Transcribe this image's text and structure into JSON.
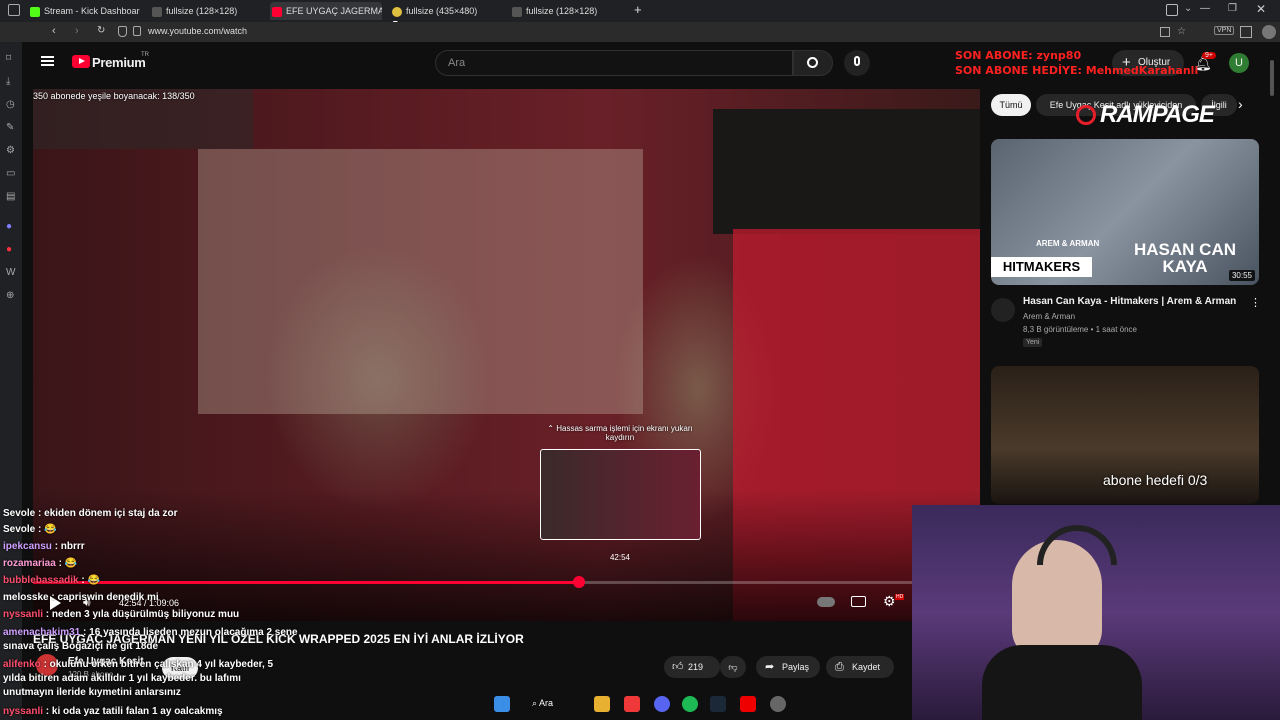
{
  "browser": {
    "tabs": [
      {
        "label": "Stream - Kick Dashboard",
        "color": "#53fc18"
      },
      {
        "label": "fullsize (128×128)",
        "color": "#888888"
      },
      {
        "label": "EFE UYGAÇ JAGERMAN YENİ",
        "color": "#ff0033"
      },
      {
        "label": "fullsize (435×480)",
        "color": "#888888"
      },
      {
        "label": "fullsize (128×128)",
        "color": "#888888"
      }
    ],
    "new_tab": "+",
    "badge_x5": "x5",
    "url": "www.youtube.com/watch",
    "vpn": "VPN"
  },
  "youtube": {
    "logo": "Premium",
    "logo_sup": "TR",
    "search_placeholder": "Ara",
    "create_label": "Oluştur",
    "notif_count": "9+",
    "avatar_letter": "U"
  },
  "overlay": {
    "last_sub": "SON ABONE: zynp80",
    "last_sub_gift": "SON ABONE HEDİYE: MehmedKarahanli",
    "sub_goal": "350 abonede yeşile boyanacak: 138/350",
    "goal_text": "abone hedefi 0/3"
  },
  "player": {
    "seek_hint": "Hassas sarma işlemi için ekranı yukarı kaydırın",
    "preview_time": "42:54",
    "time": "42:54 / 1:09:06",
    "progress": 0.62,
    "accent": "#ff0033"
  },
  "video": {
    "title": "EFE UYGAÇ JAGERMAN YENİ YIL ÖZEL KICK WRAPPED 2025 EN İYİ ANLAR İZLİYOR",
    "channel": "Efe Uygaç Kesit",
    "subs": "120 B abone",
    "join_label": "Katıl",
    "likes": "219",
    "share_label": "Paylaş",
    "save_label": "Kaydet"
  },
  "chips": [
    "Tümü",
    "Efe Uygaç Kesit adlı yükleyiciden",
    "İlgili"
  ],
  "recommendations": [
    {
      "title": "Hasan Can Kaya - Hitmakers | Arem & Arman",
      "channel": "Arem & Arman",
      "meta": "8,3 B görüntüleme • 1 saat önce",
      "badge": "Yeni",
      "duration": "30:55",
      "thumb_name": "HASAN CAN KAYA",
      "thumb_brand": "HITMAKERS",
      "thumb_tag": "AREM & ARMAN"
    }
  ],
  "rampage": "RAMPAGE",
  "chat": [
    {
      "user": "Sevole",
      "msg": "ekiden dönem içi staj da zor",
      "color": "#ffffff"
    },
    {
      "user": "Sevole",
      "msg": "😂",
      "color": "#ffffff"
    },
    {
      "user": "ipekcansu",
      "msg": "nbrrr",
      "color": "#cfa0ff"
    },
    {
      "user": "rozamariaa",
      "msg": "😂",
      "color": "#ff9dd8"
    },
    {
      "user": "bubblebassadik",
      "msg": "😂",
      "color": "#ff4d6d"
    },
    {
      "user": "melosske",
      "msg": "capriswin denedik mi",
      "color": "#ffffff"
    },
    {
      "user": "nyssanli",
      "msg": "neden 3 yıla düşürülmüş biliyonuz muu",
      "color": "#ff4d6d"
    },
    {
      "user": "amenachakim31",
      "msg": "16 yasında liseden mezun olacağıma 2 sene sınava çalış Boğaziçi ne git 18de",
      "color": "#cfa0ff"
    },
    {
      "user": "alifenko",
      "msg": "okulunu erken bitiren çalışkan 4 yıl kaybeder, 5 yılda bitiren adam akıllıdır 1 yıl kaybeder. bu lafımı unutmayın ileride kıymetini anlarsınız",
      "color": "#ff4d6d"
    },
    {
      "user": "nyssanli",
      "msg": "ki oda yaz tatili falan 1 ay oalcakmış",
      "color": "#ff4d6d"
    }
  ],
  "taskbar": {
    "search": "Ara"
  }
}
